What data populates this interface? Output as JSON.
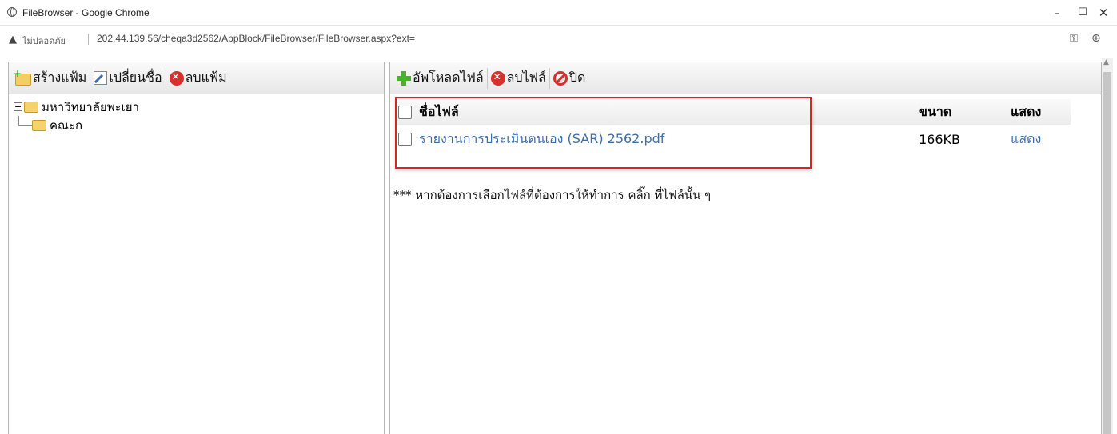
{
  "window": {
    "title": "FileBrowser - Google Chrome",
    "minimize": "–",
    "maximize": "☐",
    "close": "✕"
  },
  "address": {
    "security_label": "ไม่ปลอดภัย",
    "url": "202.44.139.56/cheqa3d2562/AppBlock/FileBrowser/FileBrowser.aspx?ext="
  },
  "left_toolbar": {
    "new_folder": "สร้างแฟ้ม",
    "rename": "เปลี่ยนชื่อ",
    "delete_folder": "ลบแฟ้ม"
  },
  "tree": {
    "toggle": "−",
    "root": "มหาวิทยาลัยพะเยา",
    "child": "คณะก"
  },
  "right_toolbar": {
    "upload": "อัพโหลดไฟล์",
    "delete_file": "ลบไฟล์",
    "close": "ปิด"
  },
  "file_table": {
    "headers": {
      "name": "ชื่อไฟล์",
      "size": "ขนาด",
      "show": "แสดง"
    },
    "rows": [
      {
        "name": "รายงานการประเมินตนเอง (SAR) 2562.pdf",
        "size": "166KB",
        "show": "แสดง"
      }
    ]
  },
  "note": "*** หากต้องการเลือกไฟล์ที่ต้องการให้ทำการ คลิ๊ก ที่ไฟล์นั้น ๆ",
  "colors": {
    "link": "#3b6ea8",
    "highlight": "#d9261c"
  }
}
